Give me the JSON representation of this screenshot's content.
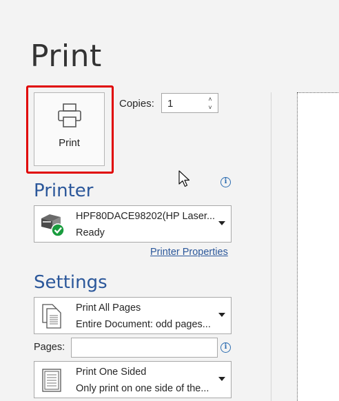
{
  "page": {
    "title": "Print"
  },
  "print_button": {
    "label": "Print"
  },
  "copies": {
    "label": "Copies:",
    "value": "1"
  },
  "printer": {
    "heading": "Printer",
    "name": "HPF80DACE98202(HP Laser...",
    "status": "Ready",
    "properties_link": "Printer Properties"
  },
  "settings": {
    "heading": "Settings",
    "pages_scope": {
      "title": "Print All Pages",
      "subtitle": "Entire Document: odd pages..."
    },
    "pages_label": "Pages:",
    "pages_value": "",
    "sides": {
      "title": "Print One Sided",
      "subtitle": "Only print on one side of the..."
    }
  },
  "colors": {
    "accent": "#2b579a",
    "highlight": "#e00000",
    "ready_green": "#1a9c3e"
  },
  "icons": [
    "printer-icon",
    "info-icon",
    "printer-device-icon",
    "pages-icon",
    "one-sided-icon",
    "mouse-cursor-icon"
  ]
}
